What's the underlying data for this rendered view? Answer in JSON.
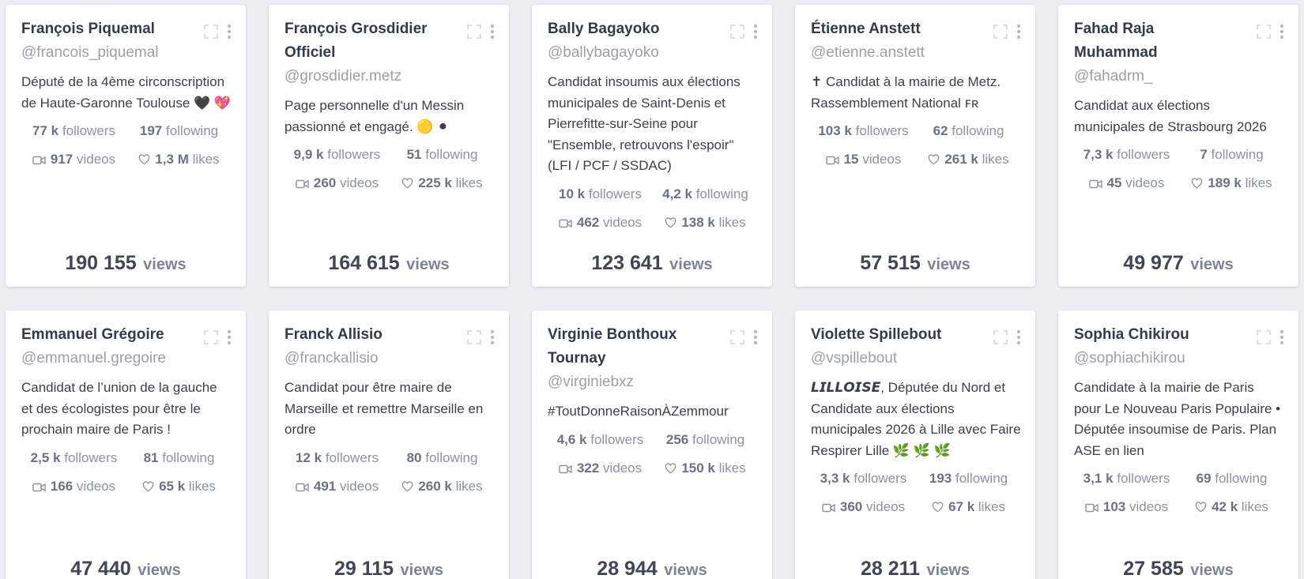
{
  "labels": {
    "followers": "followers",
    "following": "following",
    "videos": "videos",
    "likes": "likes",
    "views": "views"
  },
  "icons": {
    "expand": "expand-icon",
    "more": "more-vertical-icon",
    "video": "video-camera-icon",
    "likes": "heart-icon"
  },
  "colors": {
    "background": "#eceef3",
    "card": "#ffffff",
    "name": "#333a48",
    "handle": "#9aa0aa",
    "stat_value": "#6b7282",
    "stat_label": "#8b92a0"
  },
  "cards": [
    {
      "name": "François Piquemal",
      "handle": "@francois_piquemal",
      "bio": "Député de la 4ème circonscription de Haute-Garonne Toulouse 🖤 💖",
      "followers": "77 k",
      "following": "197",
      "videos": "917",
      "likes": "1,3 M",
      "views": "190 155"
    },
    {
      "name": "François Grosdidier Officiel",
      "handle": "@grosdidier.metz",
      "bio": "Page personnelle d'un Messin passionné et engagé. 🟡 ⚫",
      "followers": "9,9 k",
      "following": "51",
      "videos": "260",
      "likes": "225 k",
      "views": "164 615"
    },
    {
      "name": "Bally Bagayoko",
      "handle": "@ballybagayoko",
      "bio": "Candidat insoumis aux élections municipales de Saint-Denis et Pierrefitte-sur-Seine pour \"Ensemble, retrouvons l'espoir\" (LFI / PCF / SSDAC)",
      "followers": "10 k",
      "following": "4,2 k",
      "videos": "462",
      "likes": "138 k",
      "views": "123 641"
    },
    {
      "name": "Étienne Anstett",
      "handle": "@etienne.anstett",
      "bio": "✝ Candidat à la mairie de Metz. Rassemblement National ꜰʀ",
      "followers": "103 k",
      "following": "62",
      "videos": "15",
      "likes": "261 k",
      "views": "57 515"
    },
    {
      "name": "Fahad Raja Muhammad",
      "handle": "@fahadrm_",
      "bio": "Candidat aux élections municipales de Strasbourg 2026",
      "followers": "7,3 k",
      "following": "7",
      "videos": "45",
      "likes": "189 k",
      "views": "49 977"
    },
    {
      "name": "Emmanuel Grégoire",
      "handle": "@emmanuel.gregoire",
      "bio": "Candidat de l’union de la gauche et des écologistes pour être le prochain maire de Paris !",
      "followers": "2,5 k",
      "following": "81",
      "videos": "166",
      "likes": "65 k",
      "views": "47 440"
    },
    {
      "name": "Franck Allisio",
      "handle": "@franckallisio",
      "bio": "Candidat pour être maire de Marseille et remettre Marseille en ordre",
      "followers": "12 k",
      "following": "80",
      "videos": "491",
      "likes": "260 k",
      "views": "29 115"
    },
    {
      "name": "Virginie Bonthoux Tournay",
      "handle": "@virginiebxz",
      "bio": "#ToutDonneRaisonÀZemmour",
      "followers": "4,6 k",
      "following": "256",
      "videos": "322",
      "likes": "150 k",
      "views": "28 944"
    },
    {
      "name": "Violette Spillebout",
      "handle": "@vspillebout",
      "bio": "𝙇𝙄𝙇𝙇𝙊𝙄𝙎𝙀, Députée du Nord et Candidate aux élections municipales 2026 à Lille avec Faire Respirer Lille 🌿 🌿 🌿",
      "followers": "3,3 k",
      "following": "193",
      "videos": "360",
      "likes": "67 k",
      "views": "28 211"
    },
    {
      "name": "Sophia Chikirou",
      "handle": "@sophiachikirou",
      "bio": "Candidate à la mairie de Paris pour Le Nouveau Paris Populaire • Députée insoumise de Paris. Plan ASE en lien",
      "followers": "3,1 k",
      "following": "69",
      "videos": "103",
      "likes": "42 k",
      "views": "27 585"
    }
  ]
}
